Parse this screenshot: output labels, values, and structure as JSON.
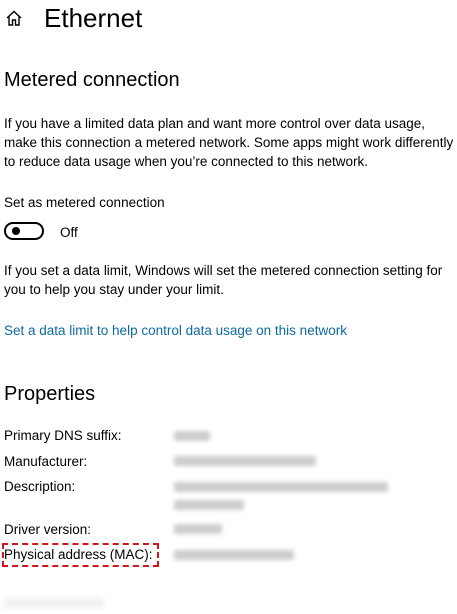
{
  "header": {
    "title": "Ethernet",
    "home_icon": "home-icon"
  },
  "metered": {
    "section_title": "Metered connection",
    "description": "If you have a limited data plan and want more control over data usage, make this connection a metered network. Some apps might work differently to reduce data usage when you’re connected to this network.",
    "toggle_label": "Set as metered connection",
    "toggle_state": "Off",
    "toggle_on": false,
    "limit_note": "If you set a data limit, Windows will set the metered connection setting for you to help you stay under your limit.",
    "limit_link": "Set a data limit to help control data usage on this network"
  },
  "properties": {
    "section_title": "Properties",
    "rows": [
      {
        "label": "Primary DNS suffix:",
        "value_redacted": true
      },
      {
        "label": "Manufacturer:",
        "value_redacted": true
      },
      {
        "label": "Description:",
        "value_redacted": true
      },
      {
        "label": "Driver version:",
        "value_redacted": true
      },
      {
        "label": "Physical address (MAC):",
        "value_redacted": true
      }
    ]
  },
  "colors": {
    "link": "#0e6a9e",
    "highlight_box": "#d4141c"
  }
}
